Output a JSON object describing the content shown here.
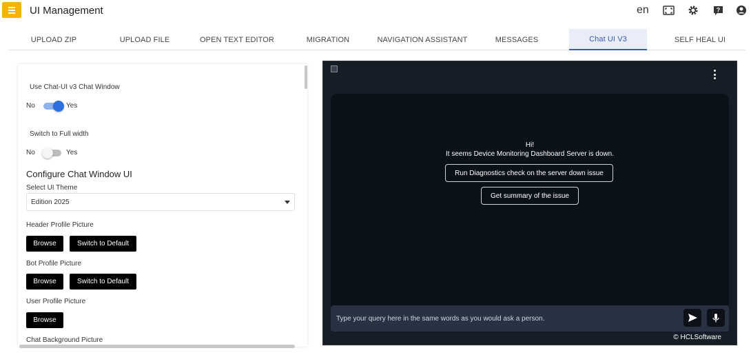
{
  "app": {
    "title": "UI Management",
    "language": "en"
  },
  "header_icons": [
    "fullscreen-icon",
    "gear-icon",
    "help-icon",
    "account-icon"
  ],
  "tabs": [
    {
      "label": "UPLOAD ZIP"
    },
    {
      "label": "UPLOAD FILE"
    },
    {
      "label": "OPEN TEXT EDITOR"
    },
    {
      "label": "MIGRATION"
    },
    {
      "label": "NAVIGATION ASSISTANT"
    },
    {
      "label": "MESSAGES"
    },
    {
      "label": "Chat UI V3"
    },
    {
      "label": "SELF HEAL UI"
    }
  ],
  "active_tab": "Chat UI V3",
  "settings": {
    "use_chat": {
      "label": "Use Chat-UI v3 Chat Window",
      "no": "No",
      "yes": "Yes",
      "value": true
    },
    "full_width": {
      "label": "Switch to Full width",
      "no": "No",
      "yes": "Yes",
      "value": false
    },
    "configure_title": "Configure Chat Window UI",
    "theme": {
      "label": "Select UI Theme",
      "value": "Edition 2025"
    },
    "header_profile": {
      "label": "Header Profile Picture",
      "browse": "Browse",
      "default": "Switch to Default"
    },
    "bot_profile": {
      "label": "Bot Profile Picture",
      "browse": "Browse",
      "default": "Switch to Default"
    },
    "user_profile": {
      "label": "User Profile Picture",
      "browse": "Browse"
    },
    "chat_bg": {
      "label": "Chat Background Picture"
    }
  },
  "chat": {
    "greeting": "Hi!",
    "message": "It seems Device Monitoring Dashboard Server is down.",
    "chips": [
      "Run Diagnostics check on the server down issue",
      "Get summary of the issue"
    ],
    "input_placeholder": "Type your query here in the same words as you would ask a person.",
    "footer": "© HCLSoftware"
  },
  "colors": {
    "accent": "#f5b400",
    "tab_active": "#3b5bb5",
    "toggle_on": "#2d6fe0",
    "chat_bg": "#151d26"
  }
}
